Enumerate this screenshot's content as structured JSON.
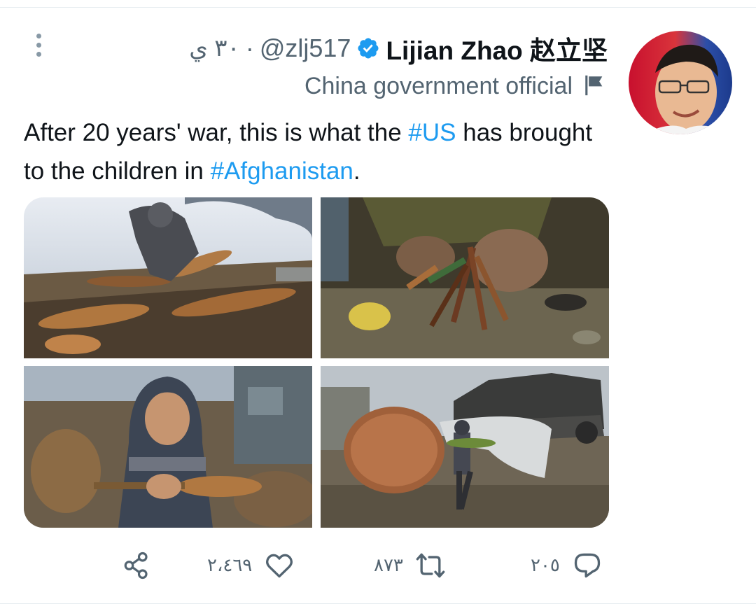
{
  "tweet": {
    "author": {
      "display_name": "Lijian Zhao 赵立坚",
      "handle": "@zlj517",
      "verified_icon": "verified-badge-icon",
      "label": "China government official",
      "label_icon": "flag-icon"
    },
    "separator": "·",
    "time": "٣٠ ي",
    "text": {
      "part1": "After 20 years' war, this is what the ",
      "hashtag1": "#US",
      "part2": " has brought to the children in ",
      "hashtag2": "#Afghanistan",
      "part3": "."
    },
    "media_count": 4,
    "actions": {
      "reply_count": "٢٠٥",
      "retweet_count": "٨٧٣",
      "like_count": "٢،٤٦٩",
      "reply_icon": "reply-icon",
      "retweet_icon": "retweet-icon",
      "like_icon": "heart-icon",
      "share_icon": "share-icon"
    },
    "more_icon": "more-options-icon"
  },
  "colors": {
    "accent": "#1d9bf0",
    "secondary_text": "#536471",
    "primary_text": "#0f1419",
    "divider": "#e6ecf0"
  }
}
